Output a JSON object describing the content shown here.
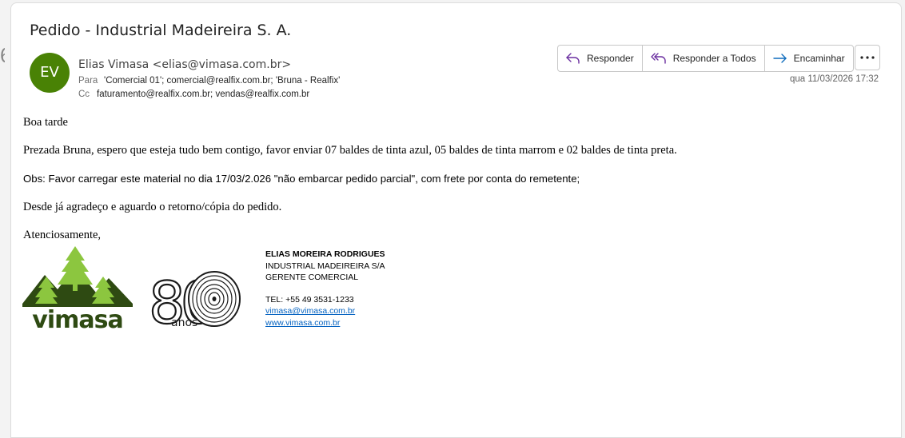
{
  "email": {
    "subject": "Pedido - Industrial Madeireira S. A.",
    "avatar_initials": "EV",
    "avatar_color": "#498205",
    "sender": "Elias Vimasa <elias@vimasa.com.br>",
    "to_label": "Para",
    "to_value": "'Comercial 01'; comercial@realfix.com.br; 'Bruna - Realfix'",
    "cc_label": "Cc",
    "cc_value": "faturamento@realfix.com.br; vendas@realfix.com.br",
    "datetime": "qua 11/03/2026 17:32"
  },
  "actions": {
    "reply": "Responder",
    "reply_all": "Responder a Todos",
    "forward": "Encaminhar",
    "accent": "#6b2fa0",
    "forward_color": "#0f6cbd",
    "more_icon": "more-icon"
  },
  "body": {
    "greeting": "Boa tarde",
    "p1": "Prezada Bruna, espero que esteja tudo bem contigo, favor enviar 07 baldes de tinta azul, 05 baldes de tinta marrom e 02 baldes de tinta preta.",
    "p2": "Obs: Favor carregar este material no dia 17/03/2.026 \"não embarcar pedido parcial\", com frete por conta do remetente;",
    "p3": "Desde já agradeço e aguardo o retorno/cópia do pedido.",
    "closing": "Atenciosamente,"
  },
  "signature": {
    "logo_text": "vimasa",
    "anniv_number": "80",
    "anniv_word": "anos",
    "name": "ELIAS MOREIRA RODRIGUES",
    "company": "INDUSTRIAL MADEIREIRA S/A",
    "role": "GERENTE COMERCIAL",
    "phone": "TEL: +55 49 3531-1233",
    "email": "vimasa@vimasa.com.br",
    "website": "www.vimasa.com.br",
    "link_color": "#0563c1",
    "logo_dark": "#2e4a12",
    "logo_light": "#8cc63f"
  }
}
